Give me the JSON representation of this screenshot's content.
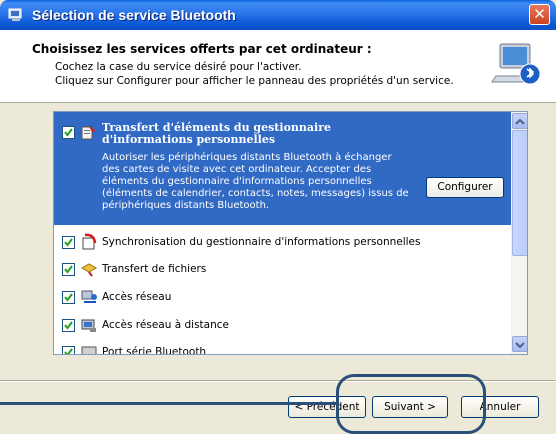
{
  "window": {
    "title": "Sélection de service Bluetooth",
    "close_symbol": "✕"
  },
  "header": {
    "title": "Choisissez les services offerts par cet ordinateur :",
    "line1": "Cochez la case du service désiré pour l'activer.",
    "line2": "Cliquez sur Configurer pour afficher le panneau des propriétés d'un service.",
    "icon": "computer-bluetooth-icon"
  },
  "services": {
    "selected": {
      "checked": true,
      "icon": "pim-transfer-icon",
      "title": "Transfert d'éléments du gestionnaire d'informations personnelles",
      "description": "Autoriser les périphériques distants Bluetooth à échanger des cartes de visite avec cet ordinateur. Accepter des éléments du gestionnaire d'informations personnelles (éléments de calendrier, contacts, notes, messages) issus de périphériques distants Bluetooth.",
      "configure_label": "Configurer"
    },
    "items": [
      {
        "label": "Synchronisation du gestionnaire d'informations personnelles",
        "checked": true,
        "icon": "sync-icon"
      },
      {
        "label": "Transfert de fichiers",
        "checked": true,
        "icon": "file-transfer-icon"
      },
      {
        "label": "Accès réseau",
        "checked": true,
        "icon": "network-access-icon"
      },
      {
        "label": "Accès réseau à distance",
        "checked": true,
        "icon": "dialup-networking-icon"
      },
      {
        "label": "Port série Bluetooth",
        "checked": true,
        "icon": "serial-port-icon"
      }
    ]
  },
  "footer": {
    "back_label": "< Précédent",
    "next_label": "Suivant >",
    "cancel_label": "Annuler"
  },
  "colors": {
    "titlebar": "#2b74e8",
    "selection": "#316ac5",
    "dialog_bg": "#ece9d8",
    "callout": "#2a5078"
  }
}
